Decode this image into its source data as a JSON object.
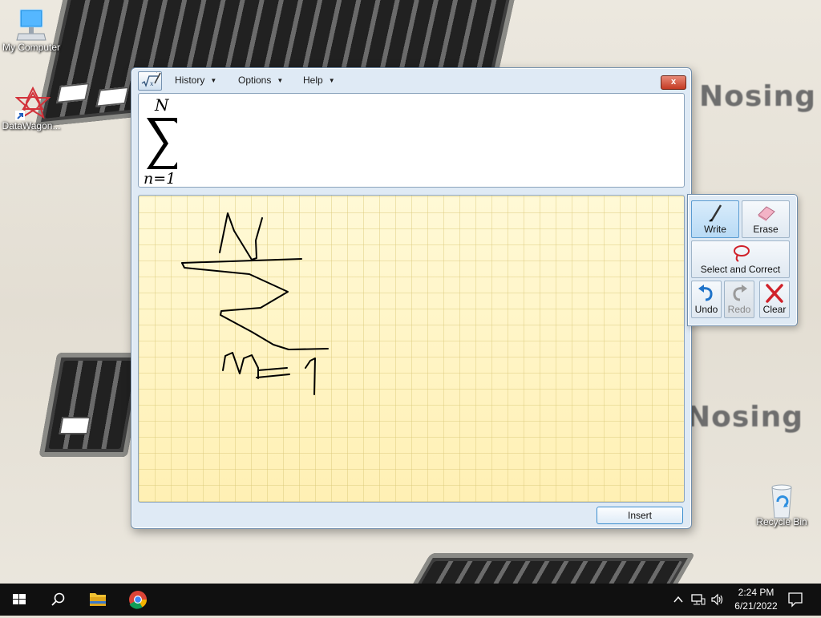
{
  "desktop": {
    "icons": [
      {
        "label": "My Computer",
        "icon": "computer-icon"
      },
      {
        "label": "DataWagon...",
        "icon": "datawagon-icon"
      },
      {
        "label": "Recycle Bin",
        "icon": "recycle-bin-icon"
      }
    ],
    "wallpaper_text": [
      "Nosing",
      "Nosing"
    ]
  },
  "math_input": {
    "menus": [
      {
        "label": "History"
      },
      {
        "label": "Options"
      },
      {
        "label": "Help"
      }
    ],
    "close_label": "x",
    "preview": {
      "upper": "N",
      "lower": "n=1"
    },
    "insert_label": "Insert"
  },
  "tools": {
    "write": "Write",
    "erase": "Erase",
    "select_correct": "Select and Correct",
    "undo": "Undo",
    "redo": "Redo",
    "clear": "Clear"
  },
  "taskbar": {
    "time": "2:24 PM",
    "date": "6/21/2022"
  },
  "colors": {
    "taskbar": "#101010",
    "canvas_top": "#fff9d6",
    "canvas_bottom": "#fff0b4",
    "accent": "#3c8fcf"
  }
}
